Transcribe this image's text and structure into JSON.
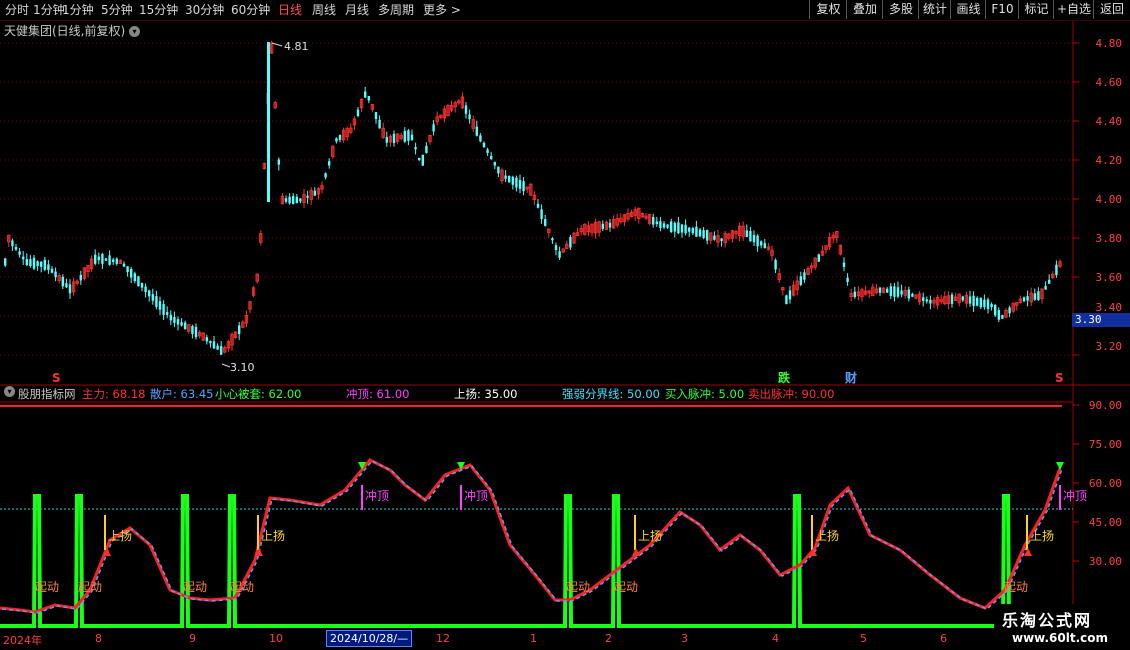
{
  "toolbar": {
    "periods": [
      "分时",
      "1分钟",
      "5分钟",
      "15分钟",
      "30分钟",
      "60分钟",
      "日线",
      "周线",
      "月线",
      "多周期",
      "更多 >"
    ],
    "active_period": "日线",
    "buttons": [
      "复权",
      "叠加",
      "多股",
      "统计",
      "画线",
      "F10",
      "标记",
      "+自选",
      "返回"
    ]
  },
  "main_chart": {
    "title": "天健集团(日线,前复权)",
    "y_ticks": [
      "4.80",
      "4.60",
      "4.40",
      "4.20",
      "4.00",
      "3.80",
      "3.60",
      "3.40",
      "3.20"
    ],
    "current_price": "3.30",
    "high_marker": "4.81",
    "low_marker": "3.10",
    "markers": [
      "S",
      "跌",
      "财",
      "S"
    ],
    "colors": {
      "up": "#ff3030",
      "down": "#54ffff",
      "grid": "#800000"
    }
  },
  "indicator": {
    "name": "股朋指标网",
    "fields": [
      {
        "label": "主力: 68.18",
        "color": "#ff3030"
      },
      {
        "label": "散户: 63.45",
        "color": "#5aa0ff"
      },
      {
        "label": "小心被套: 62.00",
        "color": "#30ff30"
      },
      {
        "label": "冲顶: 61.00",
        "color": "#ff40ff"
      },
      {
        "label": "上扬: 35.00",
        "color": "#ffffff"
      },
      {
        "label": "强弱分界线: 50.00",
        "color": "#40e0ff"
      },
      {
        "label": "买入脉冲: 5.00",
        "color": "#30ff30"
      },
      {
        "label": "卖出脉冲: 90.00",
        "color": "#ff3030"
      }
    ],
    "y_ticks": [
      "90.00",
      "75.00",
      "60.00",
      "45.00",
      "30.00"
    ],
    "signal_labels": {
      "start": "起动",
      "rise": "上扬",
      "top": "冲顶"
    }
  },
  "date_axis": {
    "labels": [
      "2024年",
      "8",
      "9",
      "10",
      "12",
      "1",
      "2",
      "3",
      "4",
      "5",
      "6"
    ],
    "cursor_date": "2024/10/28/—"
  },
  "watermark": {
    "line1": "乐淘公式网",
    "line2": "www.60lt.com"
  }
}
